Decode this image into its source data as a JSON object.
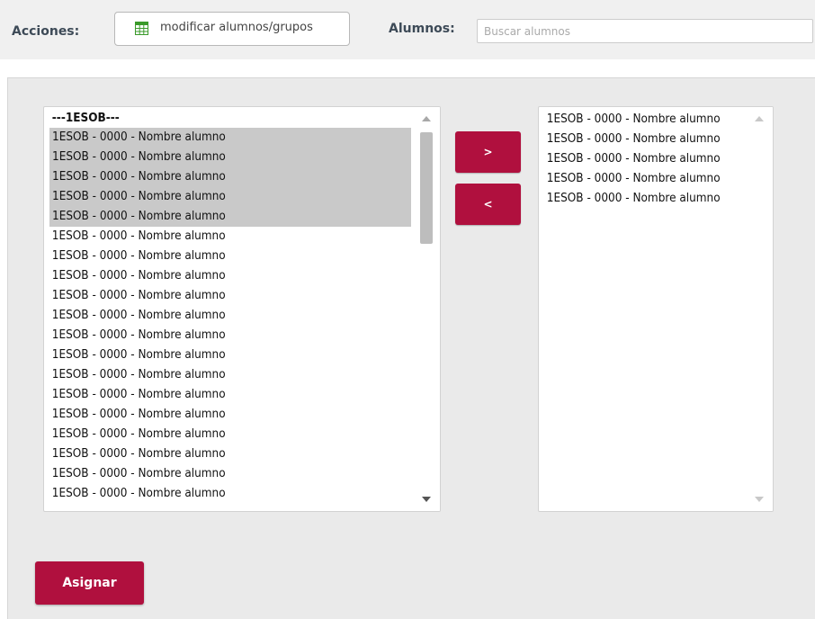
{
  "toolbar": {
    "acciones_label": "Acciones:",
    "action_button_label": "modificar alumnos/grupos",
    "action_button_icon": "grid-icon",
    "alumnos_label": "Alumnos:",
    "search_placeholder": "Buscar alumnos",
    "search_value": ""
  },
  "left_list": {
    "group_header": "---1ESOB---",
    "items": [
      "1ESOB - 0000 - Nombre alumno",
      "1ESOB - 0000 - Nombre alumno",
      "1ESOB - 0000 - Nombre alumno",
      "1ESOB - 0000 - Nombre alumno",
      "1ESOB - 0000 - Nombre alumno",
      "1ESOB - 0000 - Nombre alumno",
      "1ESOB - 0000 - Nombre alumno",
      "1ESOB - 0000 - Nombre alumno",
      "1ESOB - 0000 - Nombre alumno",
      "1ESOB - 0000 - Nombre alumno",
      "1ESOB - 0000 - Nombre alumno",
      "1ESOB - 0000 - Nombre alumno",
      "1ESOB - 0000 - Nombre alumno",
      "1ESOB - 0000 - Nombre alumno",
      "1ESOB - 0000 - Nombre alumno",
      "1ESOB - 0000 - Nombre alumno",
      "1ESOB - 0000 - Nombre alumno",
      "1ESOB - 0000 - Nombre alumno",
      "1ESOB - 0000 - Nombre alumno"
    ],
    "selected_count": 5
  },
  "right_list": {
    "items": [
      "1ESOB - 0000 - Nombre alumno",
      "1ESOB - 0000 - Nombre alumno",
      "1ESOB - 0000 - Nombre alumno",
      "1ESOB - 0000 - Nombre alumno",
      "1ESOB - 0000 - Nombre alumno"
    ]
  },
  "buttons": {
    "move_right_label": ">",
    "move_left_label": "<",
    "assign_label": "Asignar"
  },
  "colors": {
    "accent": "#b0103e",
    "selected_row": "#c9c9c9",
    "label_text": "#3d4a57",
    "panel_background": "#eaeaea"
  }
}
